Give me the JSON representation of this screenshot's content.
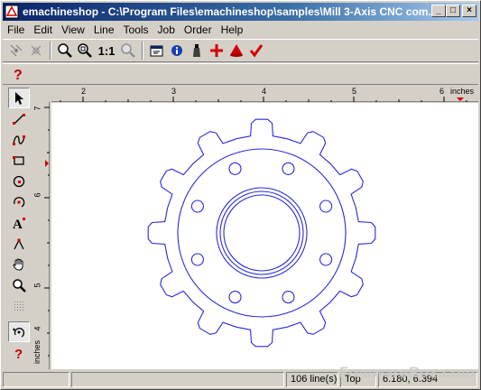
{
  "window": {
    "title": "emachineshop - C:\\Program Files\\emachineshop\\samples\\Mill 3-Axis CNC com...",
    "minimize": "_",
    "maximize": "□",
    "close": "×"
  },
  "menu": {
    "items": [
      "File",
      "Edit",
      "View",
      "Line",
      "Tools",
      "Job",
      "Order",
      "Help"
    ]
  },
  "toolbar": {
    "zoom_one_to_one": "1:1"
  },
  "rulers": {
    "h_labels": [
      "2",
      "3",
      "4",
      "5",
      "6"
    ],
    "h_unit": "inches",
    "v_labels": [
      "7",
      "6",
      "5",
      "4"
    ],
    "v_unit": "inches"
  },
  "status": {
    "pane1": "",
    "pane2": "",
    "lines": "106 line(s)",
    "view": "Top",
    "coords": "6.180, 6.394"
  },
  "watermark": "FreewareBox.com",
  "colors": {
    "drawing": "#2a2ad8",
    "titlebar_start": "#0a246a",
    "titlebar_end": "#a6caf0",
    "face": "#d4d0c8"
  }
}
